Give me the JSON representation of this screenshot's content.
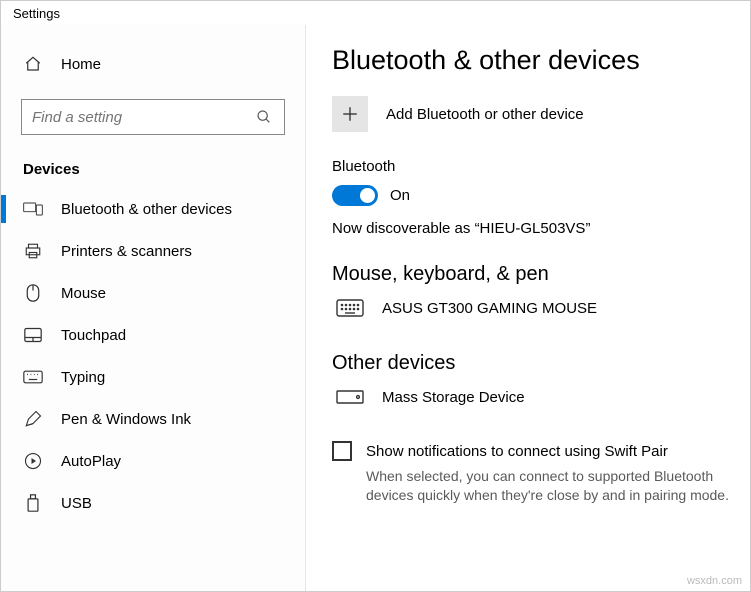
{
  "window": {
    "title": "Settings"
  },
  "sidebar": {
    "home": "Home",
    "search_placeholder": "Find a setting",
    "section": "Devices",
    "items": [
      {
        "label": "Bluetooth & other devices",
        "selected": true
      },
      {
        "label": "Printers & scanners"
      },
      {
        "label": "Mouse"
      },
      {
        "label": "Touchpad"
      },
      {
        "label": "Typing"
      },
      {
        "label": "Pen & Windows Ink"
      },
      {
        "label": "AutoPlay"
      },
      {
        "label": "USB"
      }
    ]
  },
  "page": {
    "title": "Bluetooth & other devices",
    "add_label": "Add Bluetooth or other device",
    "bluetooth_label": "Bluetooth",
    "bluetooth_on": true,
    "bluetooth_state": "On",
    "status": "Now discoverable as “HIEU-GL503VS”",
    "mouse_section": "Mouse, keyboard, & pen",
    "mouse_device": "ASUS GT300 GAMING MOUSE",
    "other_section": "Other devices",
    "other_device": "Mass Storage Device",
    "swift_checkbox": "Show notifications to connect using Swift Pair",
    "swift_help": "When selected, you can connect to supported Bluetooth devices quickly when they're close by and in pairing mode."
  },
  "watermark": "wsxdn.com"
}
